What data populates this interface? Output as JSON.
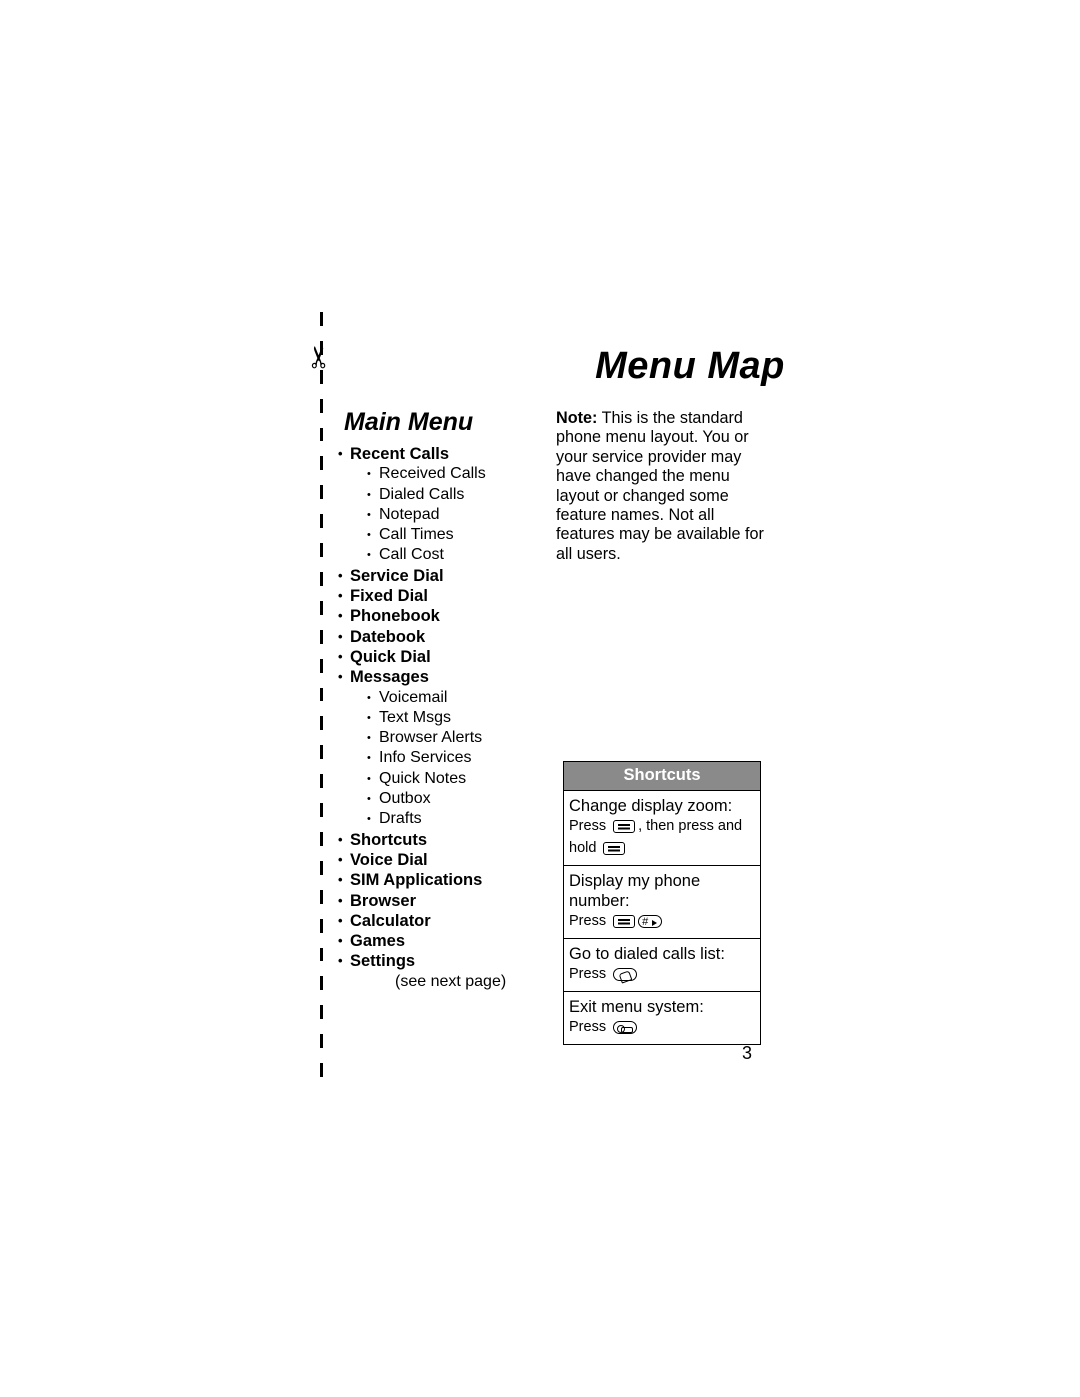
{
  "document": {
    "title": "Menu Map",
    "section_title": "Main Menu",
    "page_number": "3"
  },
  "note": {
    "label": "Note:",
    "text": " This is the standard phone menu layout. You or your service provider may have changed the menu layout or changed some feature names. Not all features may be available for all users."
  },
  "menu": {
    "items": [
      {
        "label": "Recent Calls",
        "level": 1
      },
      {
        "label": "Received Calls",
        "level": 2
      },
      {
        "label": "Dialed Calls",
        "level": 2
      },
      {
        "label": "Notepad",
        "level": 2
      },
      {
        "label": "Call Times",
        "level": 2
      },
      {
        "label": "Call Cost",
        "level": 2
      },
      {
        "label": "Service Dial",
        "level": 1
      },
      {
        "label": "Fixed Dial",
        "level": 1
      },
      {
        "label": "Phonebook",
        "level": 1
      },
      {
        "label": "Datebook",
        "level": 1
      },
      {
        "label": "Quick Dial",
        "level": 1
      },
      {
        "label": "Messages",
        "level": 1
      },
      {
        "label": "Voicemail",
        "level": 2
      },
      {
        "label": "Text Msgs",
        "level": 2
      },
      {
        "label": "Browser Alerts",
        "level": 2
      },
      {
        "label": "Info Services",
        "level": 2
      },
      {
        "label": "Quick Notes",
        "level": 2
      },
      {
        "label": "Outbox",
        "level": 2
      },
      {
        "label": "Drafts",
        "level": 2
      },
      {
        "label": "Shortcuts",
        "level": 1
      },
      {
        "label": "Voice Dial",
        "level": 1
      },
      {
        "label": "SIM Applications",
        "level": 1
      },
      {
        "label": "Browser",
        "level": 1
      },
      {
        "label": "Calculator",
        "level": 1
      },
      {
        "label": "Games",
        "level": 1
      },
      {
        "label": "Settings",
        "level": 1
      }
    ],
    "footnote": "(see next page)"
  },
  "shortcuts": {
    "header": "Shortcuts",
    "header_bg": "#8a8a8a",
    "rows": [
      {
        "label": "Change display zoom:",
        "press_prefix": "Press ",
        "keys": [
          "menu-key-icon"
        ],
        "press_middle": ", then press and",
        "press_suffix": "hold ",
        "keys2": [
          "menu-key-icon"
        ]
      },
      {
        "label": "Display my phone number:",
        "press_prefix": "Press ",
        "keys": [
          "menu-key-icon",
          "hash-key-icon"
        ],
        "press_middle": "",
        "press_suffix": "",
        "keys2": []
      },
      {
        "label": "Go to dialed calls list:",
        "press_prefix": "Press ",
        "keys": [
          "send-key-icon"
        ],
        "press_middle": "",
        "press_suffix": "",
        "keys2": []
      },
      {
        "label": "Exit menu system:",
        "press_prefix": "Press ",
        "keys": [
          "power-end-key-icon"
        ],
        "press_middle": "",
        "press_suffix": "",
        "keys2": []
      }
    ]
  }
}
